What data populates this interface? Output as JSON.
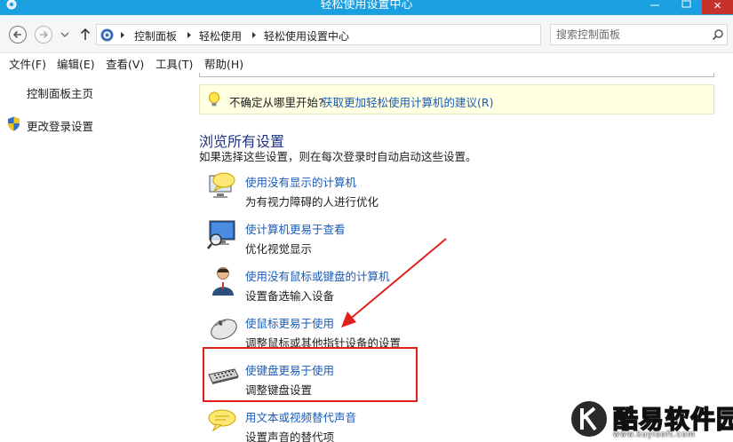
{
  "window": {
    "title": "轻松使用设置中心",
    "close_glyph": "✕"
  },
  "address": {
    "breadcrumbs": [
      "控制面板",
      "轻松使用",
      "轻松使用设置中心"
    ]
  },
  "search": {
    "placeholder": "搜索控制面板"
  },
  "menu": [
    "文件(F)",
    "编辑(E)",
    "查看(V)",
    "工具(T)",
    "帮助(H)"
  ],
  "sidebar": {
    "home": "控制面板主页",
    "login_settings": "更改登录设置"
  },
  "hint": {
    "text": "不确定从哪里开始?",
    "link": "获取更加轻松使用计算机的建议(R)"
  },
  "section": {
    "title": "浏览所有设置",
    "description": "如果选择这些设置，则在每次登录时自动启动这些设置。"
  },
  "options": [
    {
      "title": "使用没有显示的计算机",
      "subtitle": "为有视力障碍的人进行优化",
      "icon": "narrator-speech-icon"
    },
    {
      "title": "使计算机更易于查看",
      "subtitle": "优化视觉显示",
      "icon": "monitor-magnifier-icon"
    },
    {
      "title": "使用没有鼠标或键盘的计算机",
      "subtitle": "设置备选输入设备",
      "icon": "user-person-icon"
    },
    {
      "title": "使鼠标更易于使用",
      "subtitle": "调整鼠标或其他指针设备的设置",
      "icon": "mouse-icon"
    },
    {
      "title": "使键盘更易于使用",
      "subtitle": "调整键盘设置",
      "icon": "keyboard-icon"
    },
    {
      "title": "用文本或视频替代声音",
      "subtitle": "设置声音的替代项",
      "icon": "speech-bubble-icon"
    }
  ],
  "watermark": {
    "name": "酷易软件园",
    "url": "www.kuyisoft.com"
  },
  "colors": {
    "titlebar": "#1a9fe0",
    "link": "#1a5bb8",
    "heading": "#1e3287",
    "annotation": "#e0201d",
    "hint_bg": "#ffffe1"
  }
}
